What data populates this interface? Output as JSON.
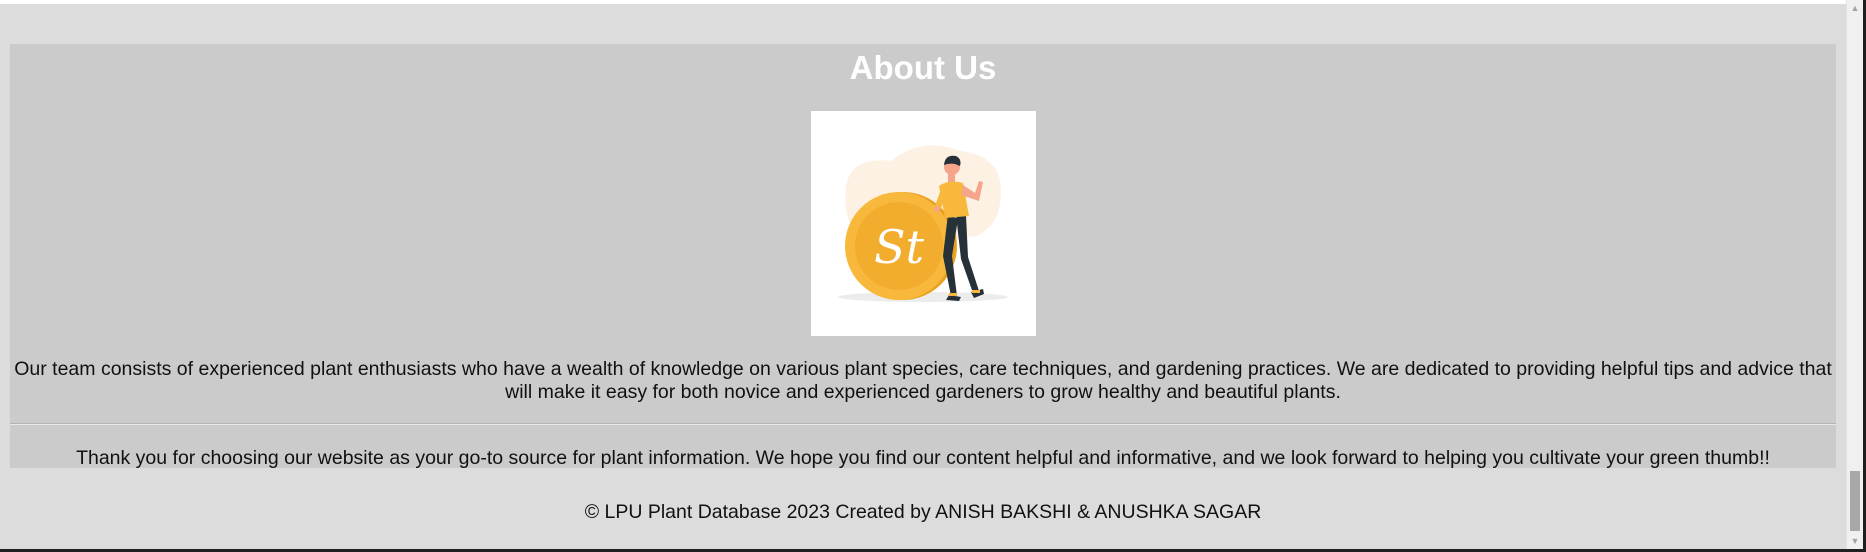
{
  "about": {
    "title": "About Us",
    "image": {
      "icon": "coin-person-illustration-icon",
      "coin_letters": "St"
    },
    "paragraph": "Our team consists of experienced plant enthusiasts who have a wealth of knowledge on various plant species, care techniques, and gardening practices. We are dedicated to providing helpful tips and advice that will make it easy for both novice and experienced gardeners to grow healthy and beautiful plants.",
    "thanks": "Thank you for choosing our website as your go-to source for plant information. We hope you find our content helpful and informative, and we look forward to helping you cultivate your green thumb!!"
  },
  "footer": {
    "text": "© LPU Plant Database 2023 Created by ANISH BAKSHI & ANUSHKA SAGAR"
  },
  "scrollbar": {
    "up_icon": "▲",
    "down_icon": "▼",
    "position": 0.97
  },
  "colors": {
    "page_background": "#dcdcdc",
    "section_background": "#cbcbcb",
    "title_color": "#ffffff",
    "coin_color": "#f7b83c",
    "text_color": "#111111"
  }
}
